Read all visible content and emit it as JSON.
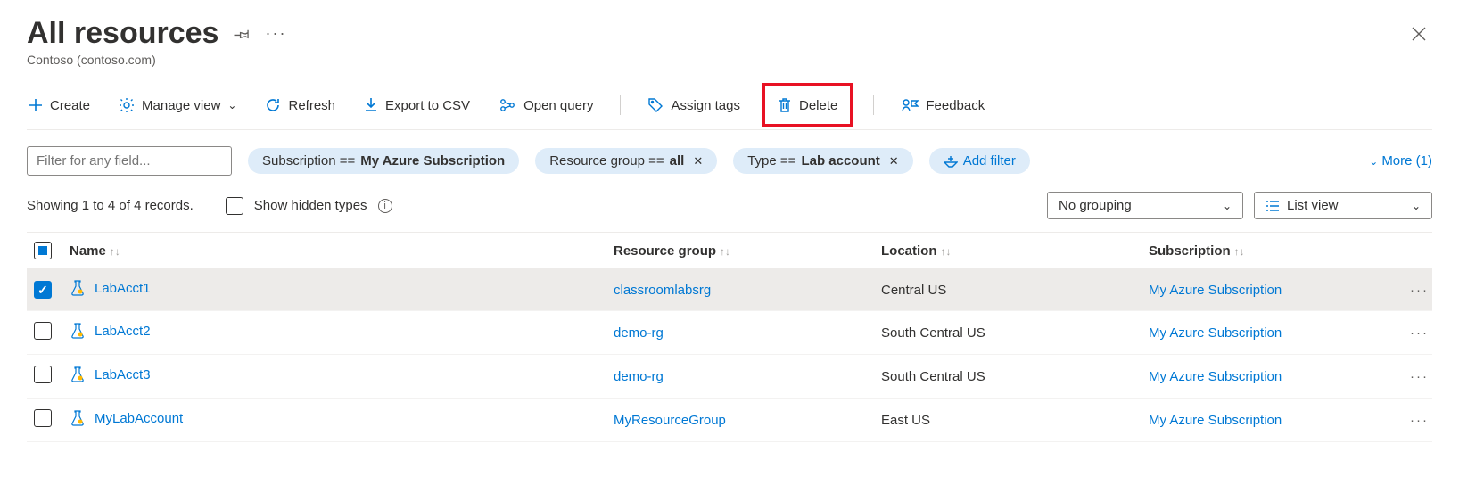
{
  "header": {
    "title": "All resources",
    "subtitle": "Contoso (contoso.com)"
  },
  "toolbar": {
    "create": "Create",
    "manage_view": "Manage view",
    "refresh": "Refresh",
    "export_csv": "Export to CSV",
    "open_query": "Open query",
    "assign_tags": "Assign tags",
    "delete": "Delete",
    "feedback": "Feedback"
  },
  "filters": {
    "placeholder": "Filter for any field...",
    "subscription_prefix": "Subscription == ",
    "subscription_value": "My Azure Subscription",
    "rg_prefix": "Resource group == ",
    "rg_value": "all",
    "type_prefix": "Type == ",
    "type_value": "Lab account",
    "add_filter": "Add filter",
    "more": "More (1)"
  },
  "status": {
    "showing": "Showing 1 to 4 of 4 records.",
    "show_hidden": "Show hidden types",
    "grouping": "No grouping",
    "view_mode": "List view"
  },
  "columns": {
    "name": "Name",
    "resource_group": "Resource group",
    "location": "Location",
    "subscription": "Subscription"
  },
  "rows": [
    {
      "name": "LabAcct1",
      "rg": "classroomlabsrg",
      "loc": "Central US",
      "sub": "My Azure Subscription",
      "checked": true
    },
    {
      "name": "LabAcct2",
      "rg": "demo-rg",
      "loc": "South Central US",
      "sub": "My Azure Subscription",
      "checked": false
    },
    {
      "name": "LabAcct3",
      "rg": "demo-rg",
      "loc": "South Central US",
      "sub": "My Azure Subscription",
      "checked": false
    },
    {
      "name": "MyLabAccount",
      "rg": "MyResourceGroup",
      "loc": "East US",
      "sub": "My Azure Subscription",
      "checked": false
    }
  ]
}
